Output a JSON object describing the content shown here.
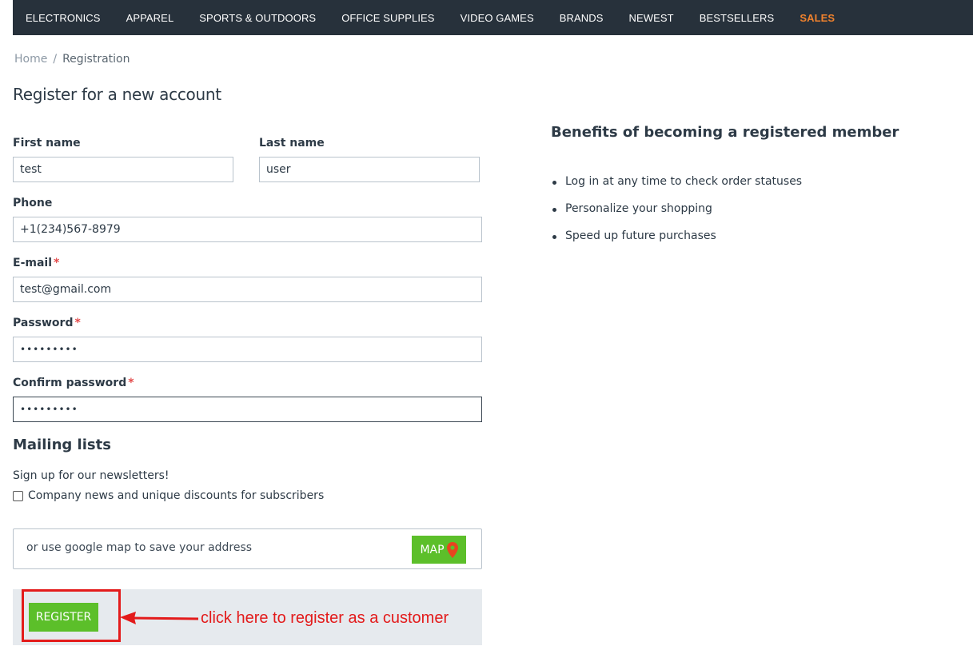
{
  "nav": {
    "items": [
      "ELECTRONICS",
      "APPAREL",
      "SPORTS & OUTDOORS",
      "OFFICE SUPPLIES",
      "VIDEO GAMES",
      "BRANDS",
      "NEWEST",
      "BESTSELLERS"
    ],
    "sales": "SALES",
    "sales_color": "#f0822d"
  },
  "breadcrumb": {
    "home": "Home",
    "separator": "/",
    "current": "Registration"
  },
  "page_title": "Register for a new account",
  "form": {
    "first_name": {
      "label": "First name",
      "value": "test"
    },
    "last_name": {
      "label": "Last name",
      "value": "user"
    },
    "phone": {
      "label": "Phone",
      "value": "+1(234)567-8979"
    },
    "email": {
      "label": "E-mail",
      "value": "test@gmail.com",
      "required_mark": "*"
    },
    "password": {
      "label": "Password",
      "value": "•••••••••",
      "required_mark": "*"
    },
    "confirm_password": {
      "label": "Confirm password",
      "value": "•••••••••",
      "required_mark": "*"
    }
  },
  "mailing": {
    "title": "Mailing lists",
    "text": "Sign up for our newsletters!",
    "option": "Company news and unique discounts for subscribers",
    "checked": false
  },
  "map": {
    "text": "or use google map to save your address",
    "button": "MAP",
    "icon": "map-pin-icon"
  },
  "register": {
    "button": "REGISTER",
    "annotation": "click here to register as a customer",
    "annotation_color": "#e31b1b",
    "button_color": "#5cbf2a"
  },
  "benefits": {
    "title": "Benefits of becoming a registered member",
    "items": [
      "Log in at any time to check order statuses",
      "Personalize your shopping",
      "Speed up future purchases"
    ]
  }
}
